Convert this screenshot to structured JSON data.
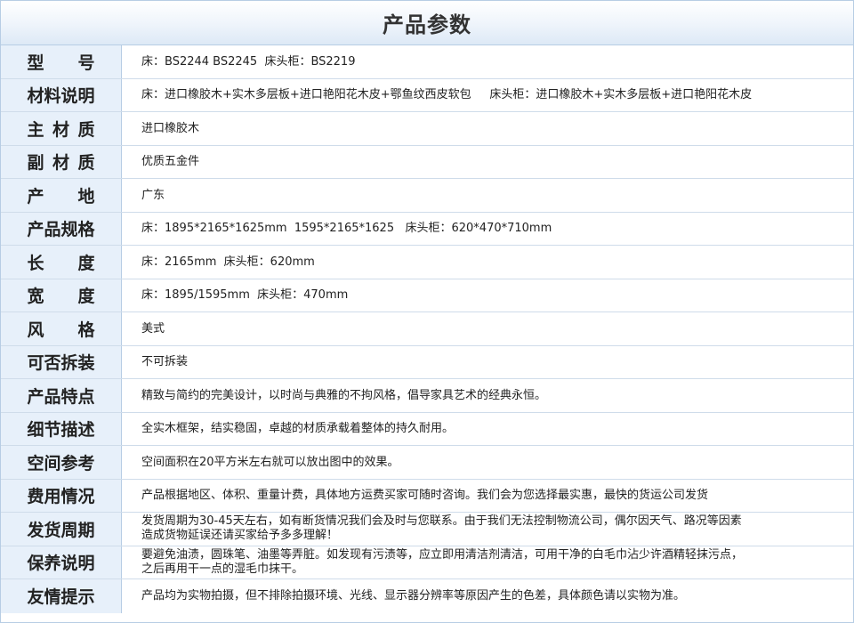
{
  "title": "产品参数",
  "rows": [
    {
      "label": "型号",
      "spaced": true,
      "value": "床：BS2244 BS2245  床头柜：BS2219"
    },
    {
      "label": "材料说明",
      "spaced": false,
      "value": "床：进口橡胶木+实木多层板+进口艳阳花木皮+鄂鱼纹西皮软包     床头柜：进口橡胶木+实木多层板+进口艳阳花木皮"
    },
    {
      "label": "主材质",
      "spaced": false,
      "value": "进口橡胶木"
    },
    {
      "label": "副材质",
      "spaced": false,
      "value": "优质五金件"
    },
    {
      "label": "产地",
      "spaced": true,
      "value": "广东"
    },
    {
      "label": "产品规格",
      "spaced": false,
      "value": "床：1895*2165*1625mm  1595*2165*1625   床头柜：620*470*710mm"
    },
    {
      "label": "长度",
      "spaced": true,
      "value": "床：2165mm  床头柜：620mm"
    },
    {
      "label": "宽度",
      "spaced": true,
      "value": "床：1895/1595mm  床头柜：470mm"
    },
    {
      "label": "风格",
      "spaced": true,
      "value": "美式"
    },
    {
      "label": "可否拆装",
      "spaced": false,
      "value": "不可拆装"
    },
    {
      "label": "产品特点",
      "spaced": false,
      "value": "精致与简约的完美设计，以时尚与典雅的不拘风格，倡导家具艺术的经典永恒。"
    },
    {
      "label": "细节描述",
      "spaced": false,
      "value": "全实木框架，结实稳固，卓越的材质承载着整体的持久耐用。"
    },
    {
      "label": "空间参考",
      "spaced": false,
      "value": "空间面积在20平方米左右就可以放出图中的效果。"
    },
    {
      "label": "费用情况",
      "spaced": false,
      "value": "产品根据地区、体积、重量计费，具体地方运费买家可随时咨询。我们会为您选择最实惠，最快的货运公司发货"
    },
    {
      "label": "发货周期",
      "spaced": false,
      "value": "发货周期为30-45天左右，如有断货情况我们会及时与您联系。由于我们无法控制物流公司，偶尔因天气、路况等因素\n造成货物延误还请买家给予多多理解！"
    },
    {
      "label": "保养说明",
      "spaced": false,
      "value": "要避免油渍，圆珠笔、油墨等弄脏。如发现有污渍等，应立即用清洁剂清洁，可用干净的白毛巾沾少许酒精轻抹污点，\n之后再用干一点的湿毛巾抹干。"
    },
    {
      "label": "友情提示",
      "spaced": false,
      "value": "产品均为实物拍摄，但不排除拍摄环境、光线、显示器分辨率等原因产生的色差，具体颜色请以实物为准。"
    }
  ]
}
